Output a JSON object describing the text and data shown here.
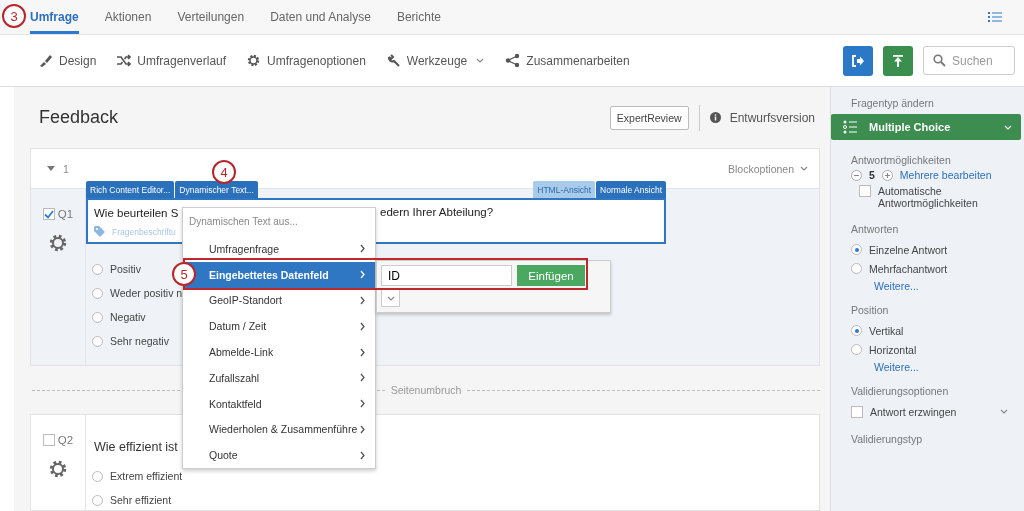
{
  "tabs": [
    {
      "label": "Umfrage",
      "selected": true
    },
    {
      "label": "Aktionen",
      "selected": false
    },
    {
      "label": "Verteilungen",
      "selected": false
    },
    {
      "label": "Daten und Analyse",
      "selected": false
    },
    {
      "label": "Berichte",
      "selected": false
    }
  ],
  "toolbar": [
    {
      "label": "Design",
      "has_menu": false
    },
    {
      "label": "Umfragenverlauf",
      "has_menu": false
    },
    {
      "label": "Umfragenoptionen",
      "has_menu": false
    },
    {
      "label": "Werkzeuge",
      "has_menu": true
    },
    {
      "label": "Zusammenarbeiten",
      "has_menu": false
    }
  ],
  "search": {
    "placeholder": "Suchen"
  },
  "survey_title": "Feedback",
  "expert_review": "ExpertReview",
  "version": "Entwurfsversion",
  "block": {
    "number": "1",
    "expanded": true,
    "options": "Blockoptionen"
  },
  "editor": {
    "tabs": [
      "Rich Content Editor...",
      "Dynamischer Text..."
    ],
    "view_tabs": [
      {
        "label": "HTML-Ansicht",
        "selected": false
      },
      {
        "label": "Normale Ansicht",
        "selected": true
      }
    ],
    "text_start": "Wie beurteilen S",
    "text_end": "edern Ihrer Abteilung?",
    "label_hint": "Fragenbeschriftu"
  },
  "questions": [
    {
      "id": "Q1",
      "checked": true,
      "choices": [
        {
          "label": "Positiv",
          "selected": false
        },
        {
          "label": "Weder positiv n",
          "selected": false
        },
        {
          "label": "Negativ",
          "selected": false
        },
        {
          "label": "Sehr negativ",
          "selected": false
        }
      ]
    },
    {
      "id": "Q2",
      "checked": false,
      "text": "Wie effizient ist",
      "choices": [
        {
          "label": "Extrem effizient",
          "selected": false
        },
        {
          "label": "Sehr effizient",
          "selected": false
        }
      ]
    }
  ],
  "page_break": "Seitenumbruch",
  "menu": {
    "title": "Dynamischen Text aus...",
    "items": [
      {
        "label": "Umfragenfrage",
        "selected": false
      },
      {
        "label": "Eingebettetes Datenfeld",
        "selected": true
      },
      {
        "label": "GeoIP-Standort",
        "selected": false
      },
      {
        "label": "Datum / Zeit",
        "selected": false
      },
      {
        "label": "Abmelde-Link",
        "selected": false
      },
      {
        "label": "Zufallszahl",
        "selected": false
      },
      {
        "label": "Kontaktfeld",
        "selected": false
      },
      {
        "label": "Wiederholen & Zusammenführe",
        "selected": false
      },
      {
        "label": "Quote",
        "selected": false
      }
    ]
  },
  "submenu": {
    "value": "ID",
    "button": "Einfügen"
  },
  "callouts": [
    "3",
    "4",
    "5"
  ],
  "side": {
    "question_type": {
      "label": "Fragentyp ändern",
      "value": "Multiple Choice"
    },
    "choices_count": {
      "label": "Antwortmöglichkeiten",
      "value": "5",
      "link": "Mehrere bearbeiten",
      "auto": {
        "label": "Automatische Antwortmöglichkeiten",
        "checked": false
      }
    },
    "answers": {
      "label": "Antworten",
      "options": [
        {
          "label": "Einzelne Antwort",
          "selected": true
        },
        {
          "label": "Mehrfachantwort",
          "selected": false
        }
      ],
      "more": "Weitere..."
    },
    "position": {
      "label": "Position",
      "options": [
        {
          "label": "Vertikal",
          "selected": true
        },
        {
          "label": "Horizontal",
          "selected": false
        }
      ],
      "more": "Weitere..."
    },
    "validation": {
      "label": "Validierungsoptionen",
      "force": {
        "label": "Antwort erzwingen",
        "checked": false
      }
    },
    "validation_type": {
      "label": "Validierungstyp"
    }
  }
}
